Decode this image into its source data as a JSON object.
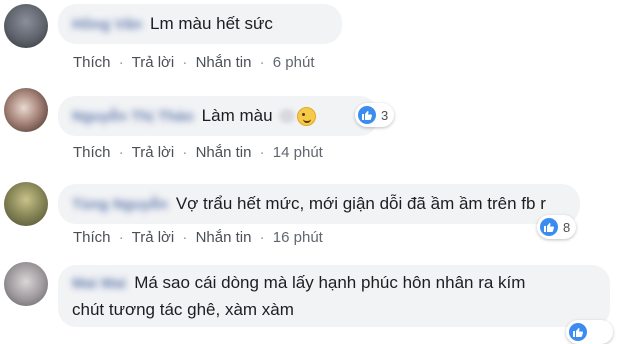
{
  "comments": [
    {
      "name": "Hồng Vân",
      "text": "Lm màu hết sức",
      "actions": {
        "like": "Thích",
        "reply": "Trả lời",
        "message": "Nhắn tin",
        "time": "6 phút",
        "sep": "·"
      }
    },
    {
      "name": "Nguyễn Thị Thảo",
      "text": "Làm màu",
      "reactions": "3",
      "actions": {
        "like": "Thích",
        "reply": "Trả lời",
        "message": "Nhắn tin",
        "time": "14 phút",
        "sep": "·"
      }
    },
    {
      "name": "Tùng Nguyễn",
      "text": "Vợ trẩu hết mức, mới giận dỗi đã ầm ầm trên fb r",
      "reactions": "8",
      "actions": {
        "like": "Thích",
        "reply": "Trả lời",
        "message": "Nhắn tin",
        "time": "16 phút",
        "sep": "·"
      }
    },
    {
      "name": "Mai Mai",
      "text_line1": "Má sao cái dòng mà lấy hạnh phúc hôn nhân ra kím",
      "text_line2": "chút tương tác ghê, xàm xàm"
    }
  ],
  "colors": {
    "link": "#385898",
    "bubble": "#f2f3f5",
    "like_blue": "#3b8cf0"
  }
}
